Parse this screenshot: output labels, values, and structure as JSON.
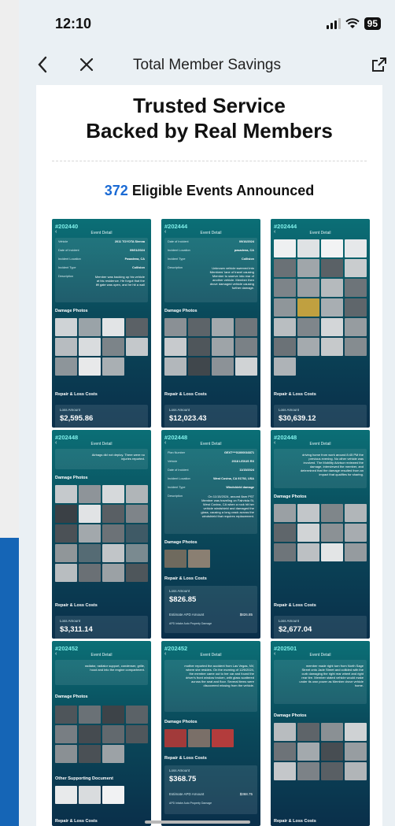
{
  "status": {
    "time": "12:10",
    "battery": "95"
  },
  "nav": {
    "title": "Total Member Savings"
  },
  "card": {
    "headline_line1": "Trusted Service",
    "headline_line2": "Backed by Real Members",
    "events_count": "372",
    "events_text": "Eligible Events Announced"
  },
  "common": {
    "event_detail": "Event Detail",
    "damage_photos": "Damage Photos",
    "repair_costs": "Repair & Loss Costs",
    "loss_amount": "Loss Amount",
    "other_docs": "Other Supporting Document",
    "estimate_apd": "Estimate APD Amount",
    "apd_sub": "APD Intake Auto Property Damage"
  },
  "tiles": [
    {
      "id": "#202440",
      "amount": "$2,595.86",
      "rows": [
        {
          "k": "Vehicle",
          "v": "2011 TOYOTA Sienna"
        },
        {
          "k": "Date of Incident",
          "v": "09/01/2024"
        },
        {
          "k": "Incident Location",
          "v": "Pasadena, CA"
        },
        {
          "k": "Incident Type",
          "v": "Collision"
        },
        {
          "k": "Description",
          "v": "Member was backing up his vehicle at his residence. He forgot that the lift gate was open, and he hit a wall"
        }
      ]
    },
    {
      "id": "#202444",
      "amount": "$12,023.43",
      "rows": [
        {
          "k": "Date of Incident",
          "v": "09/16/2024"
        },
        {
          "k": "Incident Location",
          "v": "pasadena, CA"
        },
        {
          "k": "Incident Type",
          "v": "Collision"
        },
        {
          "k": "Description",
          "v": "Unknown vehicle swerved into Members' lane of travel causing Member to swerve into rear of another vehicle. Member then drove damaged vehicle causing further damage."
        }
      ]
    },
    {
      "id": "#202444",
      "amount": "$30,639.12",
      "rows": []
    },
    {
      "id": "#202448",
      "amount": "$3,311.14",
      "rows": [
        {
          "k": "",
          "v": "Airbags did not deploy. There were no injuries reported."
        }
      ]
    },
    {
      "id": "#202448",
      "amount": "$826.85",
      "rows": [
        {
          "k": "Plan Number",
          "v": "GEXT***01000016871"
        },
        {
          "k": "Vehicle",
          "v": "2018 LEXUS RX"
        },
        {
          "k": "Date of Incident",
          "v": "11/15/2024"
        },
        {
          "k": "Incident Location",
          "v": "West Covina, CA 91792, USA"
        },
        {
          "k": "Incident Type",
          "v": "Windshield damage"
        },
        {
          "k": "Description",
          "v": "On 11/15/2024, around 8am PST Member was traveling on Fairvista St, West Covina, CA when a rock hit her vehicle windshield and damaged the glass, causing a long crack across the windshield that requires replacement."
        }
      ],
      "apd_amount": "$826.85"
    },
    {
      "id": "#202448",
      "amount": "$2,677.04",
      "rows": [
        {
          "k": "",
          "v": "driving home from work around 8:45 PM the previous evening. No other vehicle was involved. The Mobility Advisor reviewed the damage, interviewed the member, and determined that the damage resulted from an impact that qualifies for sharing."
        }
      ]
    },
    {
      "id": "#202452",
      "amount": "",
      "rows": [
        {
          "k": "",
          "v": "radiator, radiator support, condenser, grille, hood and into the engine compartment."
        }
      ]
    },
    {
      "id": "#202452",
      "amount": "$368.75",
      "rows": [
        {
          "k": "",
          "v": "mother reported the accident from Las Vegas, NV, where she resides. On the morning of 12/6/2024, the member came out to her car and found the driver's front window broken, with glass scattered across the seat and floor. Several items were discovered missing from the vehicle."
        }
      ],
      "apd_amount": "$368.75"
    },
    {
      "id": "#202501",
      "amount": "",
      "rows": [
        {
          "k": "",
          "v": "member made right turn from North Sage Street onto Jade Street and collided with the curb damaging the right rear wheel and right rear tire. Member stated vehicle would make under its own power as Member drove vehicle home."
        }
      ]
    }
  ],
  "colors": {
    "accent": "#1a6ad4",
    "tile_top": "#0b6f76",
    "tile_bottom": "#0a2f4a",
    "tile_id": "#7ff0ea"
  }
}
